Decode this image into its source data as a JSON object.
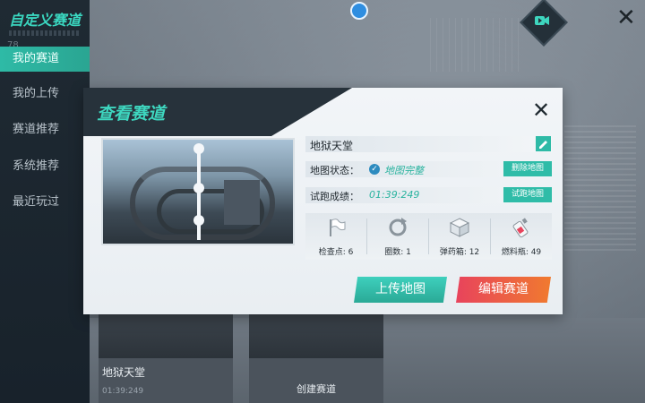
{
  "sidebar": {
    "title": "自定义赛道",
    "number": "78",
    "items": [
      {
        "label": "我的赛道",
        "active": true
      },
      {
        "label": "我的上传",
        "active": false
      },
      {
        "label": "赛道推荐",
        "active": false
      },
      {
        "label": "系统推荐",
        "active": false
      },
      {
        "label": "最近玩过",
        "active": false
      }
    ]
  },
  "background_cards": {
    "card1": {
      "label": "地狱天堂",
      "sublabel": "01:39:249"
    },
    "card2": {
      "label": "创建赛道"
    }
  },
  "modal": {
    "title": "查看赛道",
    "map_name": "地狱天堂",
    "status_label": "地图状态：",
    "status_value": "地图完整",
    "time_label": "试跑成绩：",
    "time_value": "01:39:249",
    "delete_label": "删除地图",
    "try_label": "试跑地图",
    "stats": [
      {
        "label": "检查点: 6",
        "icon": "flag-icon"
      },
      {
        "label": "圈数: 1",
        "icon": "loop-icon"
      },
      {
        "label": "弹药箱: 12",
        "icon": "ammo-box-icon"
      },
      {
        "label": "燃料瓶: 49",
        "icon": "fuel-bottle-icon"
      }
    ],
    "upload_label": "上传地图",
    "edit_label": "编辑赛道"
  },
  "colors": {
    "accent": "#2ebaa6",
    "title_teal": "#3ed6bf",
    "edit_gradient_start": "#e8435c",
    "edit_gradient_end": "#f07a2f"
  }
}
